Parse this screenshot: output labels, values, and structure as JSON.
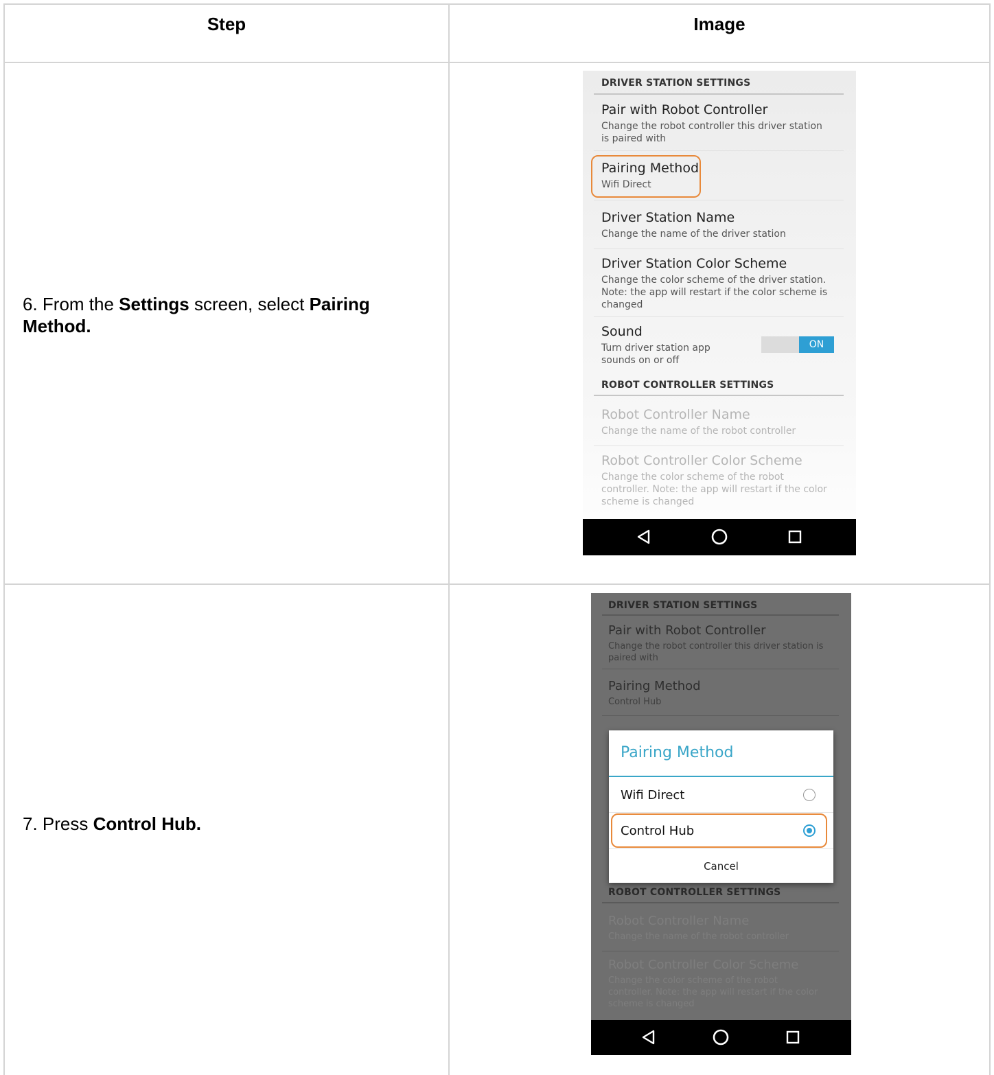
{
  "table": {
    "headers": [
      "Step",
      "Image"
    ]
  },
  "rows": [
    {
      "step": {
        "prefix": "6. From the ",
        "bold1": "Settings",
        "middle": " screen, select ",
        "bold2": "Pairing Method."
      },
      "screenshot": {
        "section1": "DRIVER STATION SETTINGS",
        "items": [
          {
            "title": "Pair with Robot Controller",
            "subtitle": "Change the robot controller this driver station is paired with"
          },
          {
            "title": "Pairing Method",
            "subtitle": "Wifi Direct"
          },
          {
            "title": "Driver Station Name",
            "subtitle": "Change the name of the driver station"
          },
          {
            "title": "Driver Station Color Scheme",
            "subtitle": "Change the color scheme of the driver station. Note: the app will restart if the color scheme is changed"
          },
          {
            "title": "Sound",
            "subtitle": "Turn driver station app sounds on or off"
          }
        ],
        "sound_toggle": "ON",
        "section2": "ROBOT CONTROLLER SETTINGS",
        "disabled_items": [
          {
            "title": "Robot Controller Name",
            "subtitle": "Change the name of the robot controller"
          },
          {
            "title": "Robot Controller Color Scheme",
            "subtitle": "Change the color scheme of the robot controller. Note: the app will restart if the color scheme is changed"
          }
        ],
        "highlight_color": "#e8893a"
      }
    },
    {
      "step": {
        "prefix": "7. Press ",
        "bold1": "Control Hub."
      },
      "screenshot": {
        "section1": "DRIVER STATION SETTINGS",
        "items": [
          {
            "title": "Pair with Robot Controller",
            "subtitle": "Change the robot controller this driver station is paired with"
          },
          {
            "title": "Pairing Method",
            "subtitle": "Control Hub"
          }
        ],
        "section2": "ROBOT CONTROLLER SETTINGS",
        "disabled_items": [
          {
            "title": "Robot Controller Name",
            "subtitle": "Change the name of the robot controller"
          },
          {
            "title": "Robot Controller Color Scheme",
            "subtitle": "Change the color scheme of the robot controller. Note: the app will restart if the color scheme is changed"
          }
        ],
        "dialog": {
          "title": "Pairing Method",
          "options": [
            {
              "label": "Wifi Direct",
              "selected": false
            },
            {
              "label": "Control Hub",
              "selected": true
            }
          ],
          "cancel": "Cancel"
        },
        "accent_color": "#3aa6c8",
        "radio_color": "#2e9fd4"
      }
    }
  ],
  "icons": {
    "back": "back-triangle-icon",
    "home": "home-circle-icon",
    "recents": "recents-square-icon",
    "radio": "radio-button-icon"
  }
}
